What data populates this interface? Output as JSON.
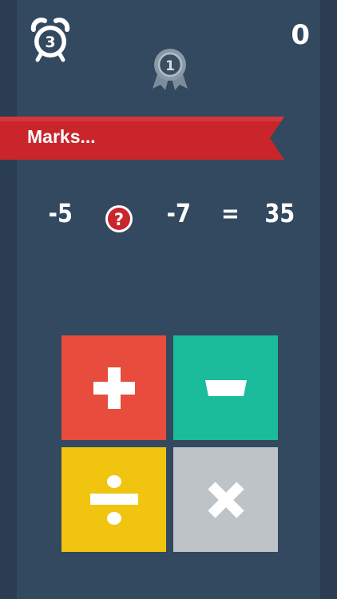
{
  "header": {
    "timer_value": "3",
    "score": "0",
    "medal_rank": "1"
  },
  "banner": {
    "text": "Marks..."
  },
  "equation": {
    "left_operand": "-5",
    "operator_placeholder": "?",
    "right_operand": "-7",
    "equals": "=",
    "result": "35"
  },
  "operator_buttons": [
    {
      "operator": "plus",
      "icon": "plus-icon",
      "color": "#e74c3c"
    },
    {
      "operator": "minus",
      "icon": "minus-icon",
      "color": "#1abc9c"
    },
    {
      "operator": "divide",
      "icon": "divide-icon",
      "color": "#f1c40f"
    },
    {
      "operator": "multiply",
      "icon": "multiply-icon",
      "color": "#bdc3c7"
    }
  ],
  "colors": {
    "background": "#2b3e51",
    "panel": "#33495f",
    "banner": "#c9252b",
    "medal": "#8a99a8"
  }
}
